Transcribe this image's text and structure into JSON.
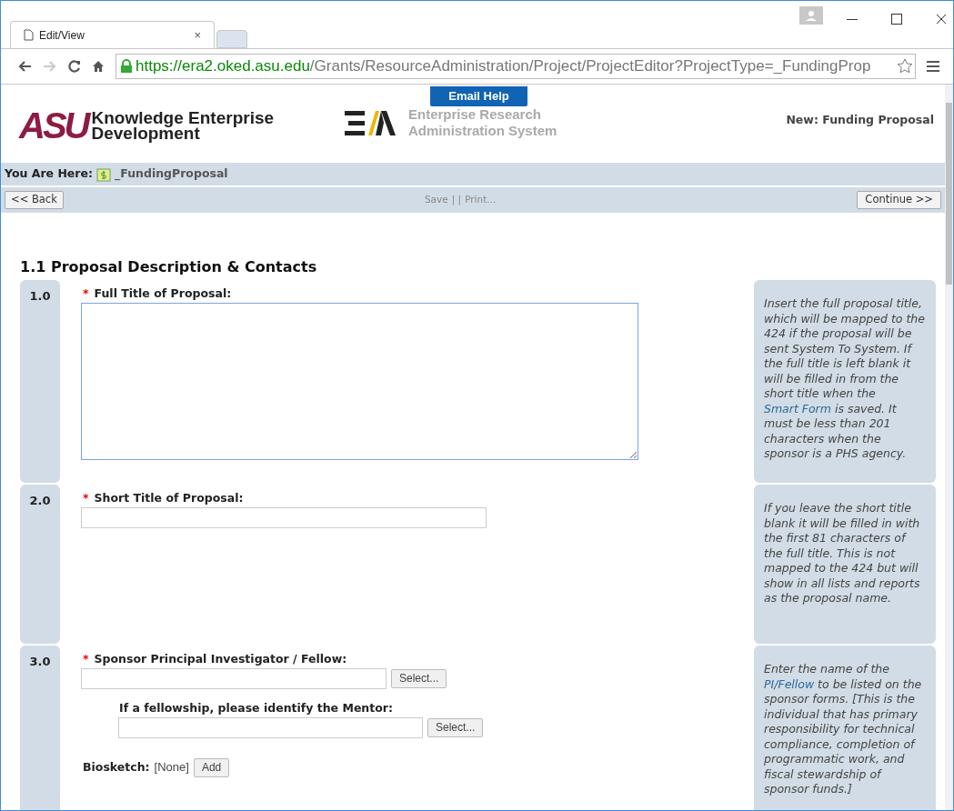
{
  "browser": {
    "tab_title": "Edit/View",
    "tab_close": "×",
    "url_host": "https://era2.oked.asu.edu",
    "url_path": "/Grants/ResourceAdministration/Project/ProjectEditor?ProjectType=_FundingProp"
  },
  "header": {
    "asu_mark": "ASU",
    "asu_name": "Knowledge Enterprise Development",
    "email_help": "Email Help",
    "era_name": "Enterprise Research Administration System",
    "page_title": "New: Funding Proposal"
  },
  "breadcrumb": {
    "label": "You Are Here:",
    "item": "_FundingProposal"
  },
  "toolbar": {
    "back": "<< Back",
    "save": "Save",
    "separator": "| |",
    "print": "Print...",
    "continue": "Continue >>"
  },
  "section_title": "1.1 Proposal Description & Contacts",
  "rows": [
    {
      "number": "1.0",
      "fields": [
        {
          "kind": "textarea",
          "marker": "*",
          "label": "Full Title of Proposal:"
        }
      ],
      "help": [
        {
          "kind": "text",
          "text": "Insert the full proposal title, which will be mapped to the 424 if the proposal will be sent System To System. If the full title is left blank it will be filled in from the short title when the "
        },
        {
          "kind": "link",
          "text": "Smart Form"
        },
        {
          "kind": "text",
          "text": " is saved. It must be less than 201 characters when the sponsor is a PHS agency."
        }
      ]
    },
    {
      "number": "2.0",
      "fields": [
        {
          "kind": "text",
          "marker": "*",
          "label": "Short Title of Proposal:"
        }
      ],
      "help": [
        {
          "kind": "text",
          "text": "If you leave the short title blank it will be filled in with the first 81 characters of the full title. This is not mapped to the 424 but will show in all lists and reports as the proposal name."
        }
      ]
    },
    {
      "number": "3.0",
      "fields": [
        {
          "kind": "select",
          "marker": "*",
          "label": "Sponsor Principal Investigator / Fellow:",
          "button": "Select..."
        },
        {
          "kind": "subselect",
          "label": "If a fellowship, please identify the Mentor:",
          "button": "Select..."
        },
        {
          "kind": "attachment",
          "label": "Biosketch:",
          "value": "[None]",
          "button": "Add"
        }
      ],
      "help": [
        {
          "kind": "text",
          "text": "Enter the name of the "
        },
        {
          "kind": "link",
          "text": "PI/Fellow"
        },
        {
          "kind": "text",
          "text": " to be listed on the sponsor forms. [This is the individual that has primary responsibility for technical compliance, completion of programmatic work, and fiscal stewardship of sponsor funds.]"
        }
      ]
    }
  ]
}
